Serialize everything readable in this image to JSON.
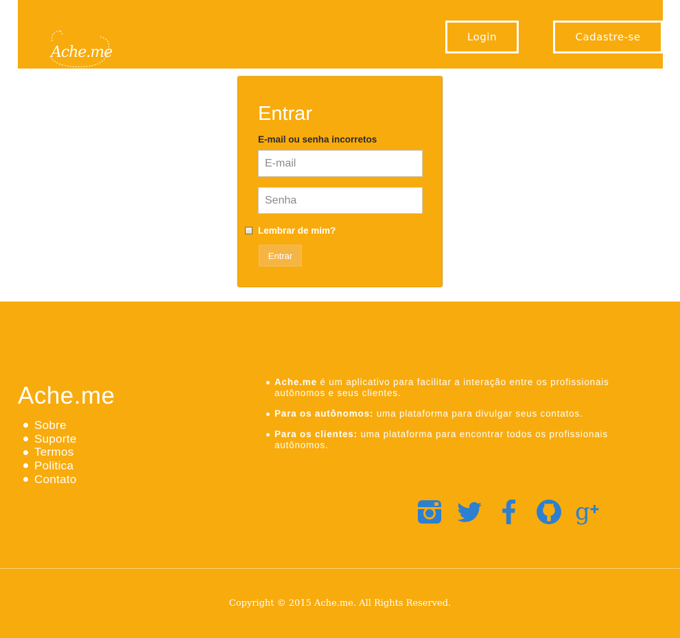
{
  "header": {
    "logo_text": "Ache.me",
    "login_label": "Login",
    "signup_label": "Cadastre-se"
  },
  "login": {
    "title": "Entrar",
    "error": "E-mail ou senha incorretos",
    "email_placeholder": "E-mail",
    "password_placeholder": "Senha",
    "remember_label": "Lembrar de mim?",
    "submit_label": "Entrar"
  },
  "footer": {
    "brand": "Ache.me",
    "links": [
      "Sobre",
      "Suporte",
      "Termos",
      "Politica",
      "Contato"
    ],
    "about": [
      {
        "strong": "Ache.me",
        "text": " é um aplicativo para facilitar a interação entre os profissionais autônomos e seus clientes."
      },
      {
        "strong": "Para os autônomos:",
        "text": " uma plataforma para divulgar seus contatos."
      },
      {
        "strong": "Para os clientes:",
        "text": " uma plataforma para encontrar todos os profissionais autônomos."
      }
    ],
    "social_icons": [
      "instagram-icon",
      "twitter-icon",
      "facebook-icon",
      "github-icon",
      "google-plus-icon"
    ],
    "copyright": "Copyright © 2015 Ache.me. All Rights Reserved."
  },
  "colors": {
    "brand": "#f8ab0c",
    "social_icon": "#2d7fd0",
    "text_light": "#ffffff"
  }
}
